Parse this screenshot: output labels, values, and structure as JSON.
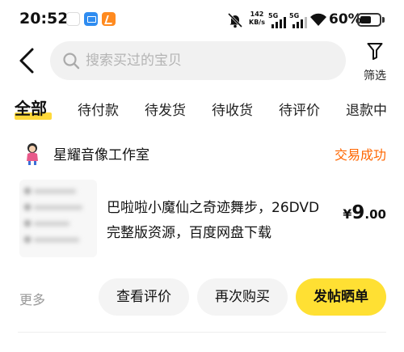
{
  "status_bar": {
    "time": "20:52",
    "net_speed_value": "142",
    "net_speed_unit": "KB/s",
    "network_1": "5G",
    "network_2": "5G",
    "battery_percent": "60%",
    "battery_level": 0.6,
    "icons": [
      "app-icon-blank",
      "app-icon-blue-chat",
      "app-icon-orange",
      "bell-muted-icon",
      "signal-icon",
      "signal-icon",
      "wifi-icon",
      "battery-icon"
    ]
  },
  "header": {
    "back_icon": "chevron-left-icon",
    "search_icon": "search-icon",
    "search_placeholder": "搜索买过的宝贝",
    "search_value": "",
    "filter_icon": "funnel-icon",
    "filter_label": "筛选"
  },
  "tabs": [
    {
      "label": "全部",
      "active": true
    },
    {
      "label": "待付款",
      "active": false
    },
    {
      "label": "待发货",
      "active": false
    },
    {
      "label": "待收货",
      "active": false
    },
    {
      "label": "待评价",
      "active": false
    },
    {
      "label": "退款中",
      "active": false
    }
  ],
  "colors": {
    "accent_yellow": "#ffe033",
    "tab_underline": "#ffd93a",
    "status_orange": "#ff6600",
    "muted_text": "#999999"
  },
  "order": {
    "shop_name": "星耀音像工作室",
    "status": "交易成功",
    "item_title": "巴啦啦小魔仙之奇迹舞步，26DVD完整版资源，百度网盘下载",
    "price_currency": "¥",
    "price_integer": "9",
    "price_decimal": ".00",
    "more_label": "更多",
    "buttons": {
      "view_review": "查看评价",
      "rebuy": "再次购买",
      "post_review": "发帖晒单"
    }
  }
}
